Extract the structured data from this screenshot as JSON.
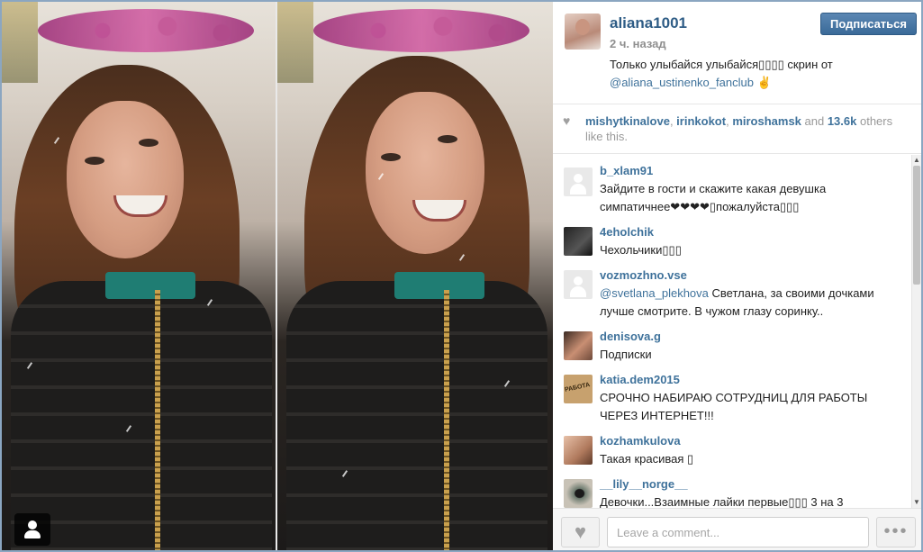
{
  "post": {
    "author": "aliana1001",
    "time": "2 ч. назад",
    "caption_text": "Только улыбайся улыбайся▯▯▯▯ скрин от",
    "caption_mention": "@aliana_ustinenko_fanclub",
    "caption_suffix": "✌"
  },
  "follow_button": "Подписаться",
  "likes": {
    "users": [
      "mishytkinalove",
      "irinkokot",
      "miroshamsk"
    ],
    "sep1": ", ",
    "sep2": ", ",
    "and": " and ",
    "count": "13.6k",
    "suffix": " others like this."
  },
  "comments": [
    {
      "user": "b_xlam91",
      "mention": "",
      "text": "Зайдите в гости и скажите какая девушка симпатичнее❤❤❤❤▯пожалуйста▯▯▯",
      "avatar": "blank"
    },
    {
      "user": "4eholchik",
      "mention": "",
      "text": "Чехольчики▯▯▯",
      "avatar": "dark"
    },
    {
      "user": "vozmozhno.vse",
      "mention": "@svetlana_plekhova",
      "text": " Светлана, за своими дочками лучше смотрите. В чужом глазу соринку..",
      "avatar": "blank"
    },
    {
      "user": "denisova.g",
      "mention": "",
      "text": "Подписки",
      "avatar": "photo"
    },
    {
      "user": "katia.dem2015",
      "mention": "",
      "text": "СРОЧНО НАБИРАЮ СОТРУДНИЦ ДЛЯ РАБОТЫ ЧЕРЕЗ ИНТЕРНЕТ!!!",
      "avatar": "sign",
      "avatar_label": "РАБОТА"
    },
    {
      "user": "kozhamkulova",
      "mention": "",
      "text": "Такая красивая ▯",
      "avatar": "photo2"
    },
    {
      "user": "__lily__norge__",
      "mention": "",
      "text": "Девочки...Взаимные лайки первые▯▯▯ 3 на 3",
      "avatar": "eye"
    }
  ],
  "footer": {
    "comment_placeholder": "Leave a comment...",
    "more_label": "•••"
  },
  "icons": {
    "heart": "heart-icon",
    "user_tag": "user-tag-icon",
    "more": "more-options-icon"
  },
  "colors": {
    "link": "#3f729b",
    "author": "#2f5d86",
    "follow_button": "#4a79a6"
  }
}
